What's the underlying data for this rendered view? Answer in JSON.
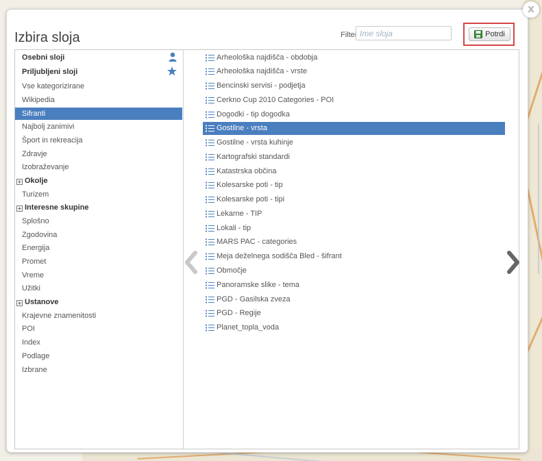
{
  "dialog": {
    "title": "Izbira sloja",
    "filter_label": "Filter:",
    "filter_placeholder": "Ime sloja",
    "filter_value": "",
    "confirm_label": "Potrdi",
    "close_label": "x"
  },
  "sidebar": {
    "items": [
      {
        "label": "Osebni sloji",
        "bold": true,
        "icon": "user-icon"
      },
      {
        "label": "Priljubljeni sloji",
        "bold": true,
        "icon": "star-icon"
      },
      {
        "label": "Vse kategorizirane"
      },
      {
        "label": "Wikipedia"
      },
      {
        "label": "Sifranti",
        "selected": true
      },
      {
        "label": "Najbolj zanimivi"
      },
      {
        "label": "Šport in rekreacija"
      },
      {
        "label": "Zdravje"
      },
      {
        "label": "Izobraževanje"
      },
      {
        "label": "Okolje",
        "bold": true,
        "expandable": true
      },
      {
        "label": "Turizem"
      },
      {
        "label": "Interesne skupine",
        "bold": true,
        "expandable": true
      },
      {
        "label": "Splošno"
      },
      {
        "label": "Zgodovina"
      },
      {
        "label": "Energija"
      },
      {
        "label": "Promet"
      },
      {
        "label": "Vreme"
      },
      {
        "label": "Užitki"
      },
      {
        "label": "Ustanove",
        "bold": true,
        "expandable": true
      },
      {
        "label": "Krajevne znamenitosti"
      },
      {
        "label": "POI"
      },
      {
        "label": "Index"
      },
      {
        "label": "Podlage"
      },
      {
        "label": "Izbrane"
      }
    ]
  },
  "layers": {
    "items": [
      {
        "label": "Arheološka najdišča - obdobja"
      },
      {
        "label": "Arheološka najdišča - vrste"
      },
      {
        "label": "Bencinski servisi - podjetja"
      },
      {
        "label": "Cerkno Cup 2010 Categories - POI"
      },
      {
        "label": "Dogodki - tip dogodka"
      },
      {
        "label": "Gostilne - vrsta",
        "selected": true
      },
      {
        "label": "Gostilne - vrsta kuhinje"
      },
      {
        "label": "Kartografski standardi"
      },
      {
        "label": "Katastrska občina"
      },
      {
        "label": "Kolesarske poti - tip"
      },
      {
        "label": "Kolesarske poti - tipi"
      },
      {
        "label": "Lekarne - TIP"
      },
      {
        "label": "Lokali - tip"
      },
      {
        "label": "MARS PAC - categories"
      },
      {
        "label": "Meja deželnega sodišča Bled - šifrant"
      },
      {
        "label": "Območje"
      },
      {
        "label": "Panoramske slike - tema"
      },
      {
        "label": "PGD - Gasilska zveza"
      },
      {
        "label": "PGD - Regije"
      },
      {
        "label": "Planet_topla_voda"
      }
    ]
  },
  "colors": {
    "selection": "#4a7fbf",
    "confirm_highlight": "#d64545",
    "icon_blue": "#4a7fbf",
    "save_icon_green": "#3b8a3b"
  }
}
